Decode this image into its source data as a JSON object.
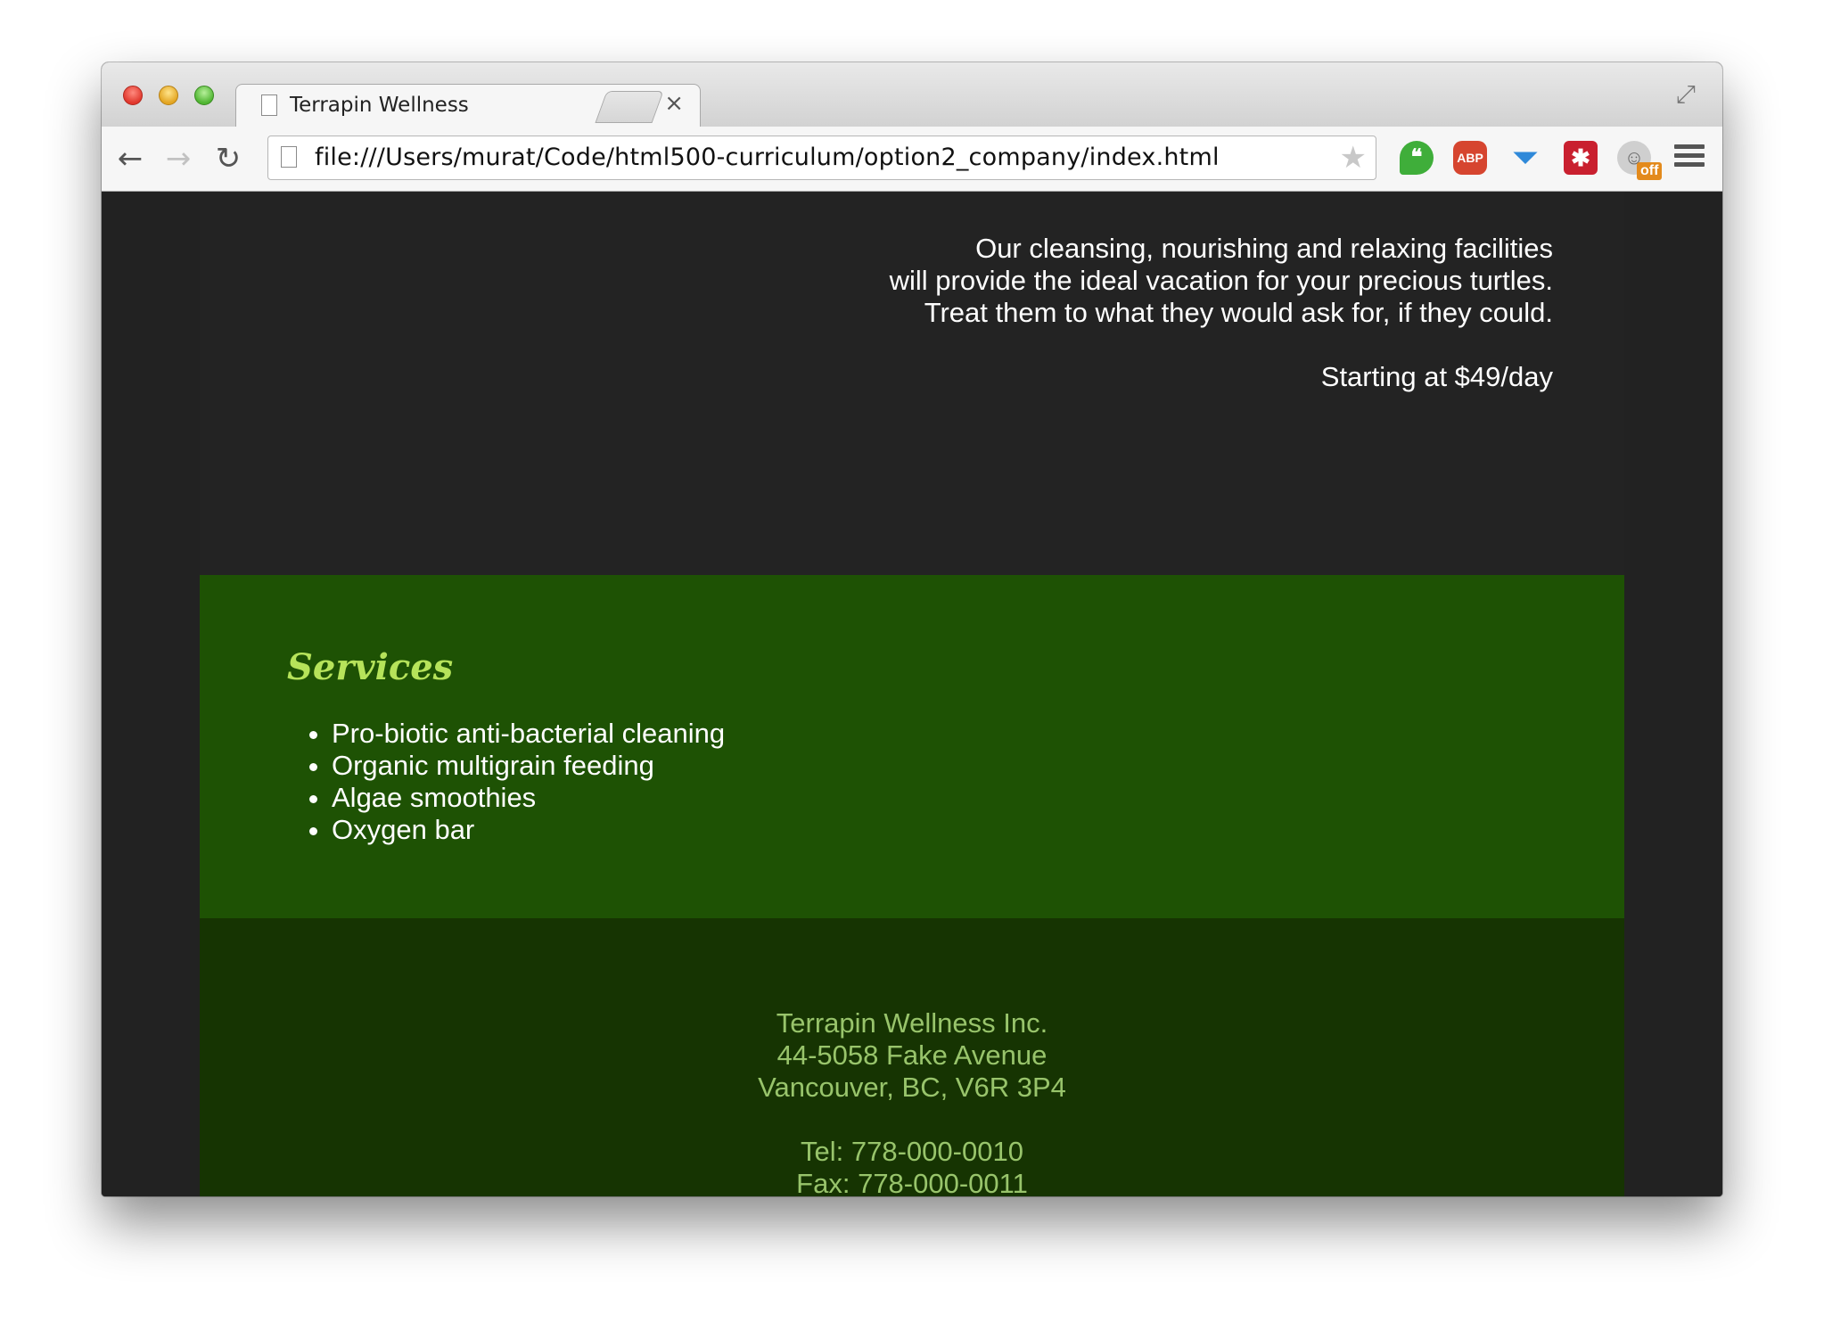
{
  "browser": {
    "tab_title": "Terrapin Wellness",
    "tab_close": "×",
    "url": "file:///Users/murat/Code/html500-curriculum/option2_company/index.html",
    "back": "←",
    "forward": "→",
    "reload": "↻",
    "star": "★",
    "fullscreen": "⤢",
    "extensions": {
      "hangouts": "❝",
      "abp": "ABP",
      "funnel": "⏷",
      "lastpass": "✱",
      "ghost": "☺",
      "ghost_badge": "off"
    }
  },
  "hero": {
    "lines": [
      "Our cleansing, nourishing and relaxing facilities",
      "will provide the ideal vacation for your precious turtles.",
      "Treat them to what they would ask for, if they could."
    ],
    "price": "Starting at $49/day"
  },
  "services": {
    "title": "Services",
    "items": [
      "Pro-biotic anti-bacterial cleaning",
      "Organic multigrain feeding",
      "Algae smoothies",
      "Oxygen bar"
    ]
  },
  "footer": {
    "company": "Terrapin Wellness Inc.",
    "street": "44-5058 Fake Avenue",
    "city": "Vancouver, BC, V6R 3P4",
    "tel": "Tel: 778-000-0010",
    "fax": "Fax: 778-000-0011"
  },
  "colors": {
    "hero_bg": "#232323",
    "services_bg": "#1e5204",
    "services_title": "#b6e35a",
    "footer_bg": "#163402",
    "footer_text": "#98c46b"
  }
}
